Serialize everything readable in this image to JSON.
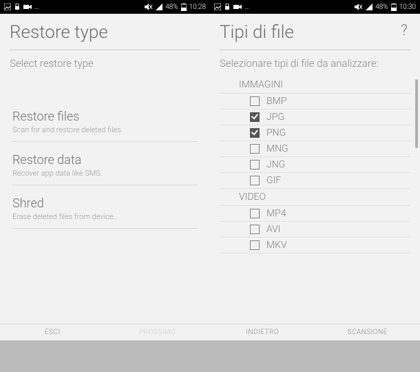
{
  "left": {
    "status": {
      "battery": "48%",
      "time": "10:28"
    },
    "title": "Restore type",
    "subtitle": "Select restore type",
    "options": [
      {
        "title": "Restore files",
        "desc": "Scan for and restore deleted files."
      },
      {
        "title": "Restore data",
        "desc": "Recover app data like SMS."
      },
      {
        "title": "Shred",
        "desc": "Erase deleted files from device."
      }
    ],
    "footer": {
      "left": "ESCI",
      "right": "PROSSIMO"
    }
  },
  "right": {
    "status": {
      "battery": "48%",
      "time": "10:30"
    },
    "title": "Tipi di file",
    "subtitle": "Selezionare tipi di file da analizzare:",
    "groups": [
      {
        "category": "IMMAGINI",
        "items": [
          {
            "label": "BMP",
            "checked": false
          },
          {
            "label": "JPG",
            "checked": true
          },
          {
            "label": "PNG",
            "checked": true
          },
          {
            "label": "MNG",
            "checked": false
          },
          {
            "label": "JNG",
            "checked": false
          },
          {
            "label": "GIF",
            "checked": false
          }
        ]
      },
      {
        "category": "VIDEO",
        "items": [
          {
            "label": "MP4",
            "checked": false
          },
          {
            "label": "AVI",
            "checked": false
          },
          {
            "label": "MKV",
            "checked": false
          }
        ]
      }
    ],
    "footer": {
      "left": "INDIETRO",
      "right": "SCANSIONE"
    }
  }
}
